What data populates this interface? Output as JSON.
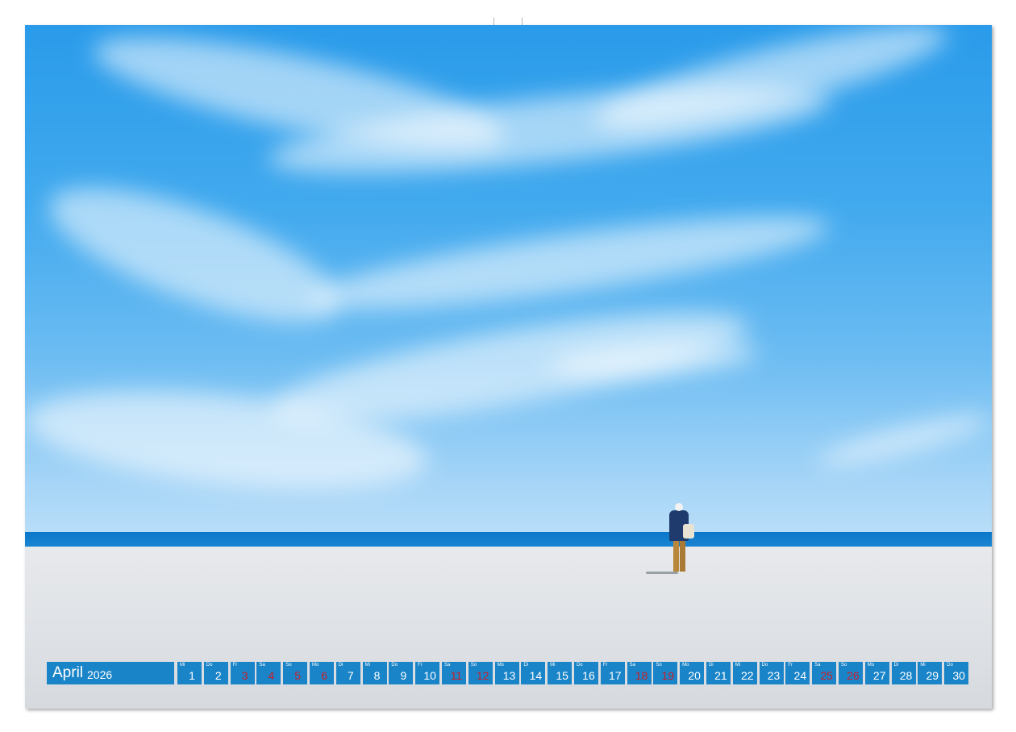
{
  "calendar": {
    "month": "April",
    "year": "2026",
    "days": [
      {
        "wd": "Mi",
        "n": "1",
        "h": false
      },
      {
        "wd": "Do",
        "n": "2",
        "h": false
      },
      {
        "wd": "Fr",
        "n": "3",
        "h": true
      },
      {
        "wd": "Sa",
        "n": "4",
        "h": true
      },
      {
        "wd": "So",
        "n": "5",
        "h": true
      },
      {
        "wd": "Mo",
        "n": "6",
        "h": true
      },
      {
        "wd": "Di",
        "n": "7",
        "h": false
      },
      {
        "wd": "Mi",
        "n": "8",
        "h": false
      },
      {
        "wd": "Do",
        "n": "9",
        "h": false
      },
      {
        "wd": "Fr",
        "n": "10",
        "h": false
      },
      {
        "wd": "Sa",
        "n": "11",
        "h": true
      },
      {
        "wd": "So",
        "n": "12",
        "h": true
      },
      {
        "wd": "Mo",
        "n": "13",
        "h": false
      },
      {
        "wd": "Di",
        "n": "14",
        "h": false
      },
      {
        "wd": "Mi",
        "n": "15",
        "h": false
      },
      {
        "wd": "Do",
        "n": "16",
        "h": false
      },
      {
        "wd": "Fr",
        "n": "17",
        "h": false
      },
      {
        "wd": "Sa",
        "n": "18",
        "h": true
      },
      {
        "wd": "So",
        "n": "19",
        "h": true
      },
      {
        "wd": "Mo",
        "n": "20",
        "h": false
      },
      {
        "wd": "Di",
        "n": "21",
        "h": false
      },
      {
        "wd": "Mi",
        "n": "22",
        "h": false
      },
      {
        "wd": "Do",
        "n": "23",
        "h": false
      },
      {
        "wd": "Fr",
        "n": "24",
        "h": false
      },
      {
        "wd": "Sa",
        "n": "25",
        "h": true
      },
      {
        "wd": "So",
        "n": "26",
        "h": true
      },
      {
        "wd": "Mo",
        "n": "27",
        "h": false
      },
      {
        "wd": "Di",
        "n": "28",
        "h": false
      },
      {
        "wd": "Mi",
        "n": "29",
        "h": false
      },
      {
        "wd": "Do",
        "n": "30",
        "h": false
      }
    ]
  },
  "colors": {
    "bar": "#1a84c8",
    "holiday_text": "#c8202a",
    "sky": "#2a9bea",
    "sea": "#0a76c9",
    "sand": "#dfe2e6"
  }
}
